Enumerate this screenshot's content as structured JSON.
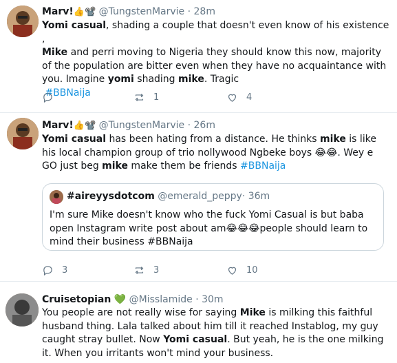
{
  "tweets": [
    {
      "name": "Marv!",
      "emoji": "👍📽️",
      "handle": "@TungstenMarvie",
      "time": "· 28m",
      "text_1_b": "Yomi casual",
      "text_1": ", shading a couple that doesn't even know of his existence ,",
      "text_2_b": "Mike",
      "text_2": " and perri moving to Nigeria they should know this now, majority of the population are bitter even when they have no acquaintance with you. Imagine ",
      "text_3_b": "yomi",
      "text_3": " shading ",
      "text_4_b": "mike",
      "text_4": ". Tragic",
      "hashtag": "#BBNaija",
      "replies": "",
      "retweets": "1",
      "likes": "4"
    },
    {
      "name": "Marv!",
      "emoji": "👍📽️",
      "handle": "@TungstenMarvie",
      "time": "· 26m",
      "text_1_b": "Yomi casual",
      "text_1": " has been hating from a distance. He thinks ",
      "text_2_b": "mike",
      "text_2": " is like his local champion group of trio nollywood Ngbeke boys 😂😂. Wey e GO just beg ",
      "text_3_b": "mike",
      "text_3": " make them be friends ",
      "hashtag": "#BBNaija",
      "quote": {
        "name": "#aireyysdotcom",
        "handle": "@emerald_peppy",
        "time": "· 36m",
        "text": "I'm sure Mike doesn't know who the fuck Yomi Casual is but baba open Instagram write post about am😂😂😂people should learn to mind their business #BBNaija"
      },
      "replies": "3",
      "retweets": "3",
      "likes": "10"
    },
    {
      "name": "Cruisetopian",
      "emoji": "💚",
      "handle": "@Misslamide",
      "time": "· 30m",
      "text_1": "You people are not really wise for saying ",
      "text_1_b": "Mike",
      "text_2": " is milking this faithful husband thing. Lala talked about him till it reached Instablog, my guy caught stray bullet. Now ",
      "text_2_b": "Yomi casual",
      "text_3": ". But yeah, he is the one milking it. When you irritants won't mind your business."
    }
  ]
}
